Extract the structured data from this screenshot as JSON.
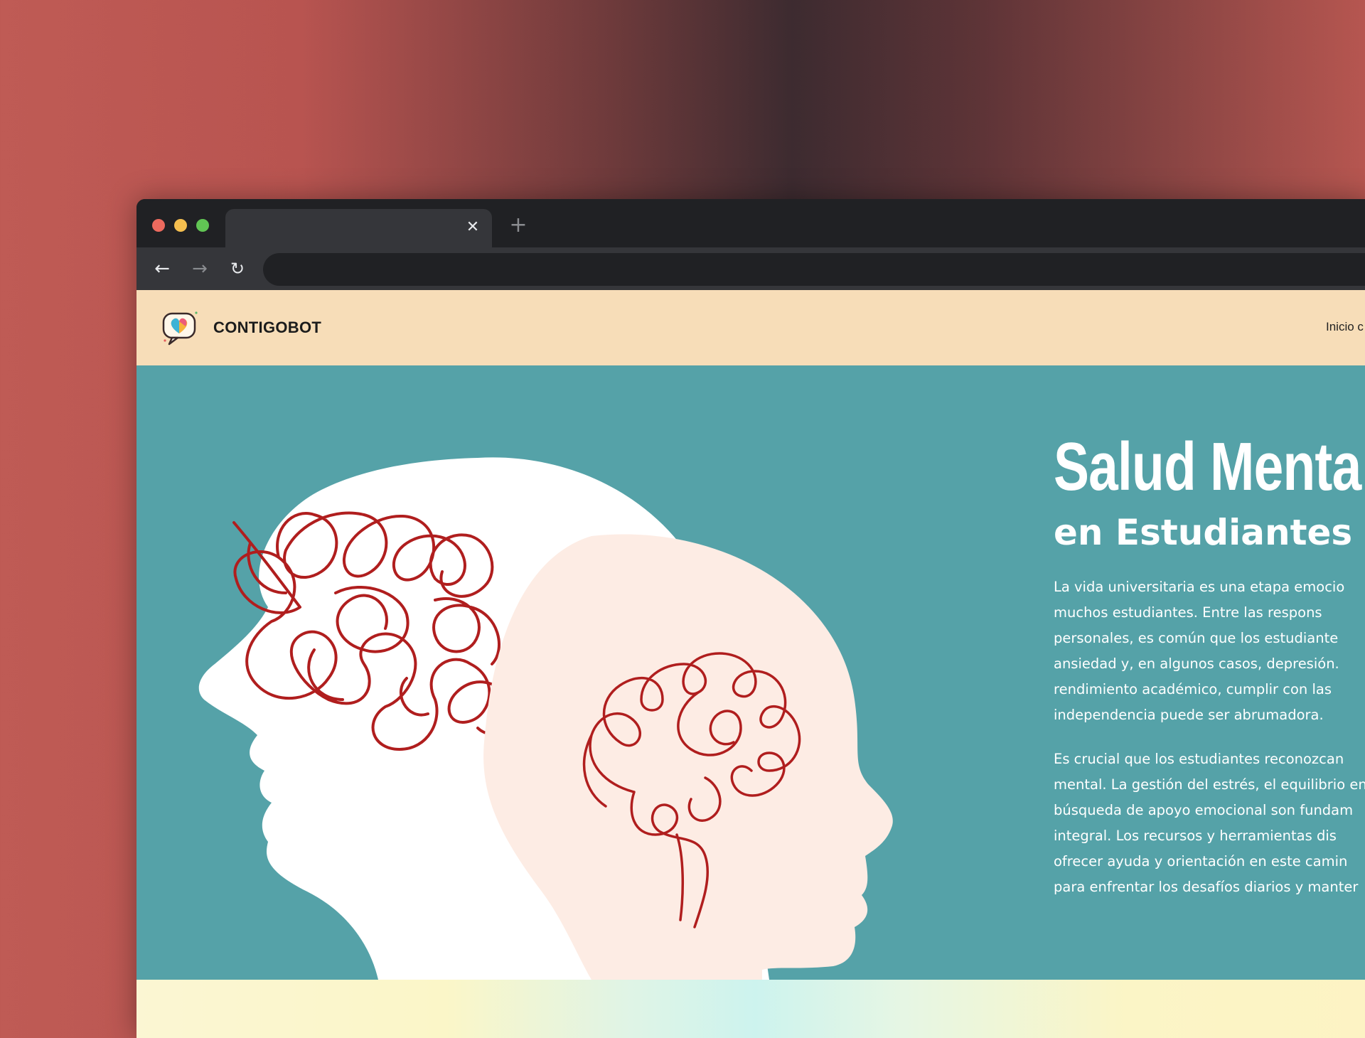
{
  "browser": {
    "tab": {
      "title": "",
      "close_glyph": "✕"
    },
    "new_tab_glyph": "+",
    "nav": {
      "back_glyph": "←",
      "forward_glyph": "→",
      "reload_glyph": "↻"
    },
    "address": ""
  },
  "site": {
    "brand": "CONTIGOBOT",
    "nav": [
      {
        "label": "Inicio c"
      }
    ]
  },
  "hero": {
    "title": "Salud Menta",
    "subtitle": "en Estudiantes U",
    "paragraph1_lines": [
      "La vida universitaria es una etapa emocio",
      "muchos estudiantes. Entre las respons",
      "personales, es común que los estudiante",
      "ansiedad y, en algunos casos, depresión.",
      "rendimiento académico, cumplir con las",
      "independencia puede ser abrumadora."
    ],
    "paragraph2_lines": [
      "Es crucial que los estudiantes reconozcan",
      "mental. La gestión del estrés, el equilibrio en",
      "búsqueda de apoyo emocional son fundam",
      "integral. Los recursos y herramientas dis",
      "ofrecer ayuda y orientación en este camin",
      "para enfrentar los desafíos diarios y manter"
    ]
  },
  "colors": {
    "header_bg": "#f7ddb8",
    "hero_bg": "#55a2a8",
    "scribble": "#b01e1e",
    "head_left": "#ffffff",
    "head_right": "#fdece4"
  },
  "icons": [
    "heart-chat-logo-icon",
    "close-icon",
    "plus-icon",
    "back-arrow-icon",
    "forward-arrow-icon",
    "reload-icon"
  ]
}
